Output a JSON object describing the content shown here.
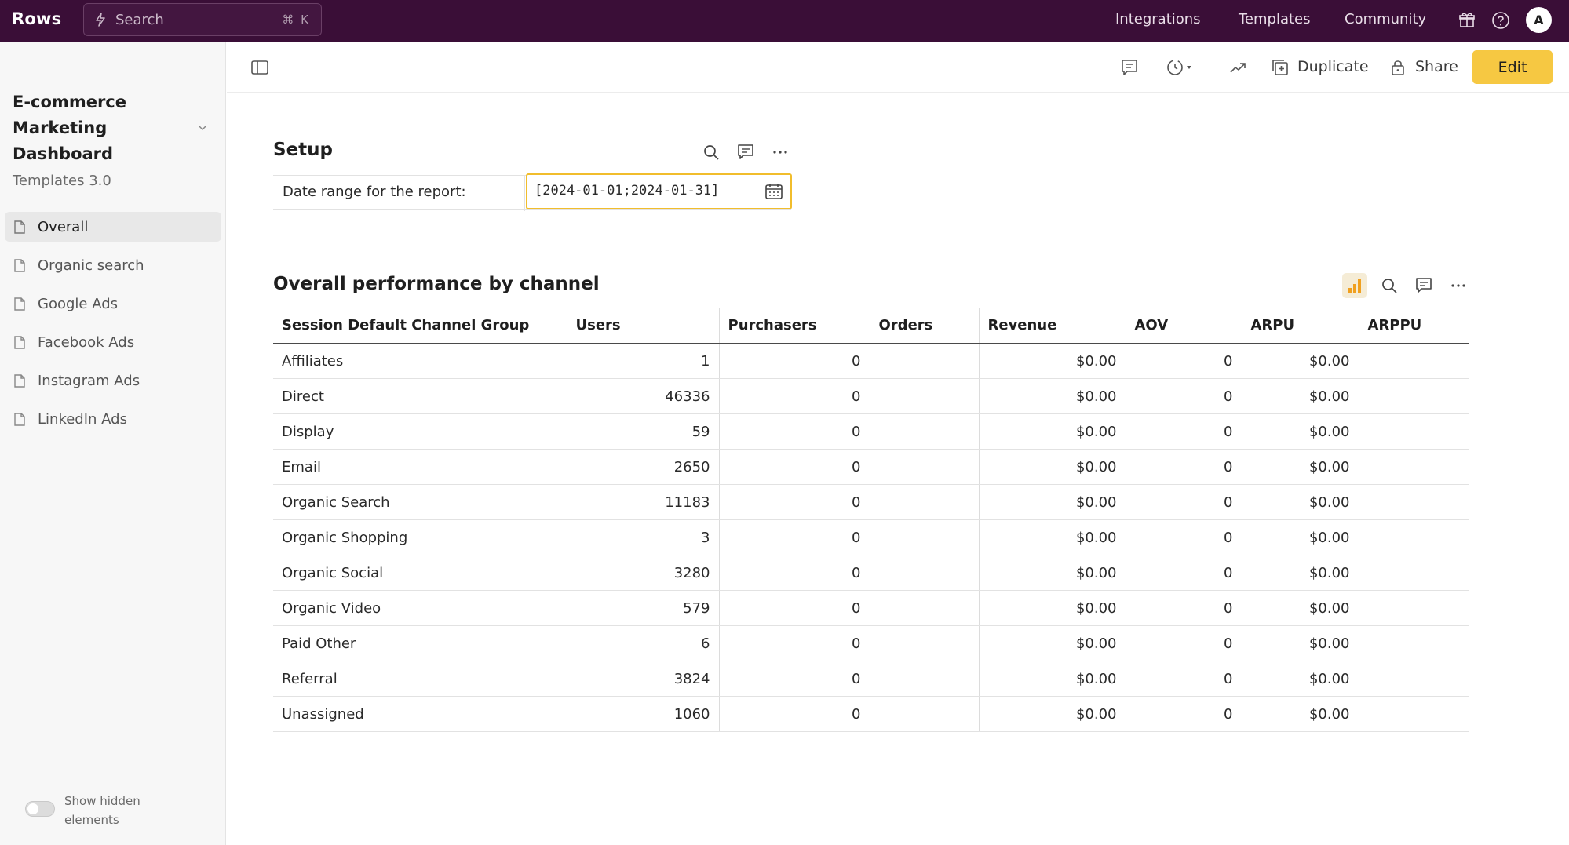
{
  "topbar": {
    "logo": "Rows",
    "search_placeholder": "Search",
    "search_shortcut": "⌘ K",
    "nav": [
      "Integrations",
      "Templates",
      "Community"
    ],
    "avatar_initial": "A"
  },
  "sidebar": {
    "doc_title": "E-commerce Marketing Dashboard",
    "doc_subtitle": "Templates 3.0",
    "items": [
      {
        "label": "Overall",
        "active": true
      },
      {
        "label": "Organic search",
        "active": false
      },
      {
        "label": "Google Ads",
        "active": false
      },
      {
        "label": "Facebook Ads",
        "active": false
      },
      {
        "label": "Instagram Ads",
        "active": false
      },
      {
        "label": "LinkedIn Ads",
        "active": false
      }
    ],
    "toggle_label": "Show hidden elements"
  },
  "toolbar": {
    "duplicate_label": "Duplicate",
    "share_label": "Share",
    "edit_label": "Edit"
  },
  "setup": {
    "title": "Setup",
    "row_label": "Date range for the report:",
    "row_value": "[2024-01-01;2024-01-31]"
  },
  "performance": {
    "title": "Overall performance by channel",
    "columns": [
      "Session Default Channel Group",
      "Users",
      "Purchasers",
      "Orders",
      "Revenue",
      "AOV",
      "ARPU",
      "ARPPU"
    ],
    "rows": [
      [
        "Affiliates",
        "1",
        "0",
        "",
        "$0.00",
        "0",
        "$0.00",
        ""
      ],
      [
        "Direct",
        "46336",
        "0",
        "",
        "$0.00",
        "0",
        "$0.00",
        ""
      ],
      [
        "Display",
        "59",
        "0",
        "",
        "$0.00",
        "0",
        "$0.00",
        ""
      ],
      [
        "Email",
        "2650",
        "0",
        "",
        "$0.00",
        "0",
        "$0.00",
        ""
      ],
      [
        "Organic Search",
        "11183",
        "0",
        "",
        "$0.00",
        "0",
        "$0.00",
        ""
      ],
      [
        "Organic Shopping",
        "3",
        "0",
        "",
        "$0.00",
        "0",
        "$0.00",
        ""
      ],
      [
        "Organic Social",
        "3280",
        "0",
        "",
        "$0.00",
        "0",
        "$0.00",
        ""
      ],
      [
        "Organic Video",
        "579",
        "0",
        "",
        "$0.00",
        "0",
        "$0.00",
        ""
      ],
      [
        "Paid Other",
        "6",
        "0",
        "",
        "$0.00",
        "0",
        "$0.00",
        ""
      ],
      [
        "Referral",
        "3824",
        "0",
        "",
        "$0.00",
        "0",
        "$0.00",
        ""
      ],
      [
        "Unassigned",
        "1060",
        "0",
        "",
        "$0.00",
        "0",
        "$0.00",
        ""
      ]
    ]
  },
  "colors": {
    "topbar_bg": "#3a0e37",
    "accent_yellow": "#f6c842",
    "input_border": "#f1bd2c"
  }
}
